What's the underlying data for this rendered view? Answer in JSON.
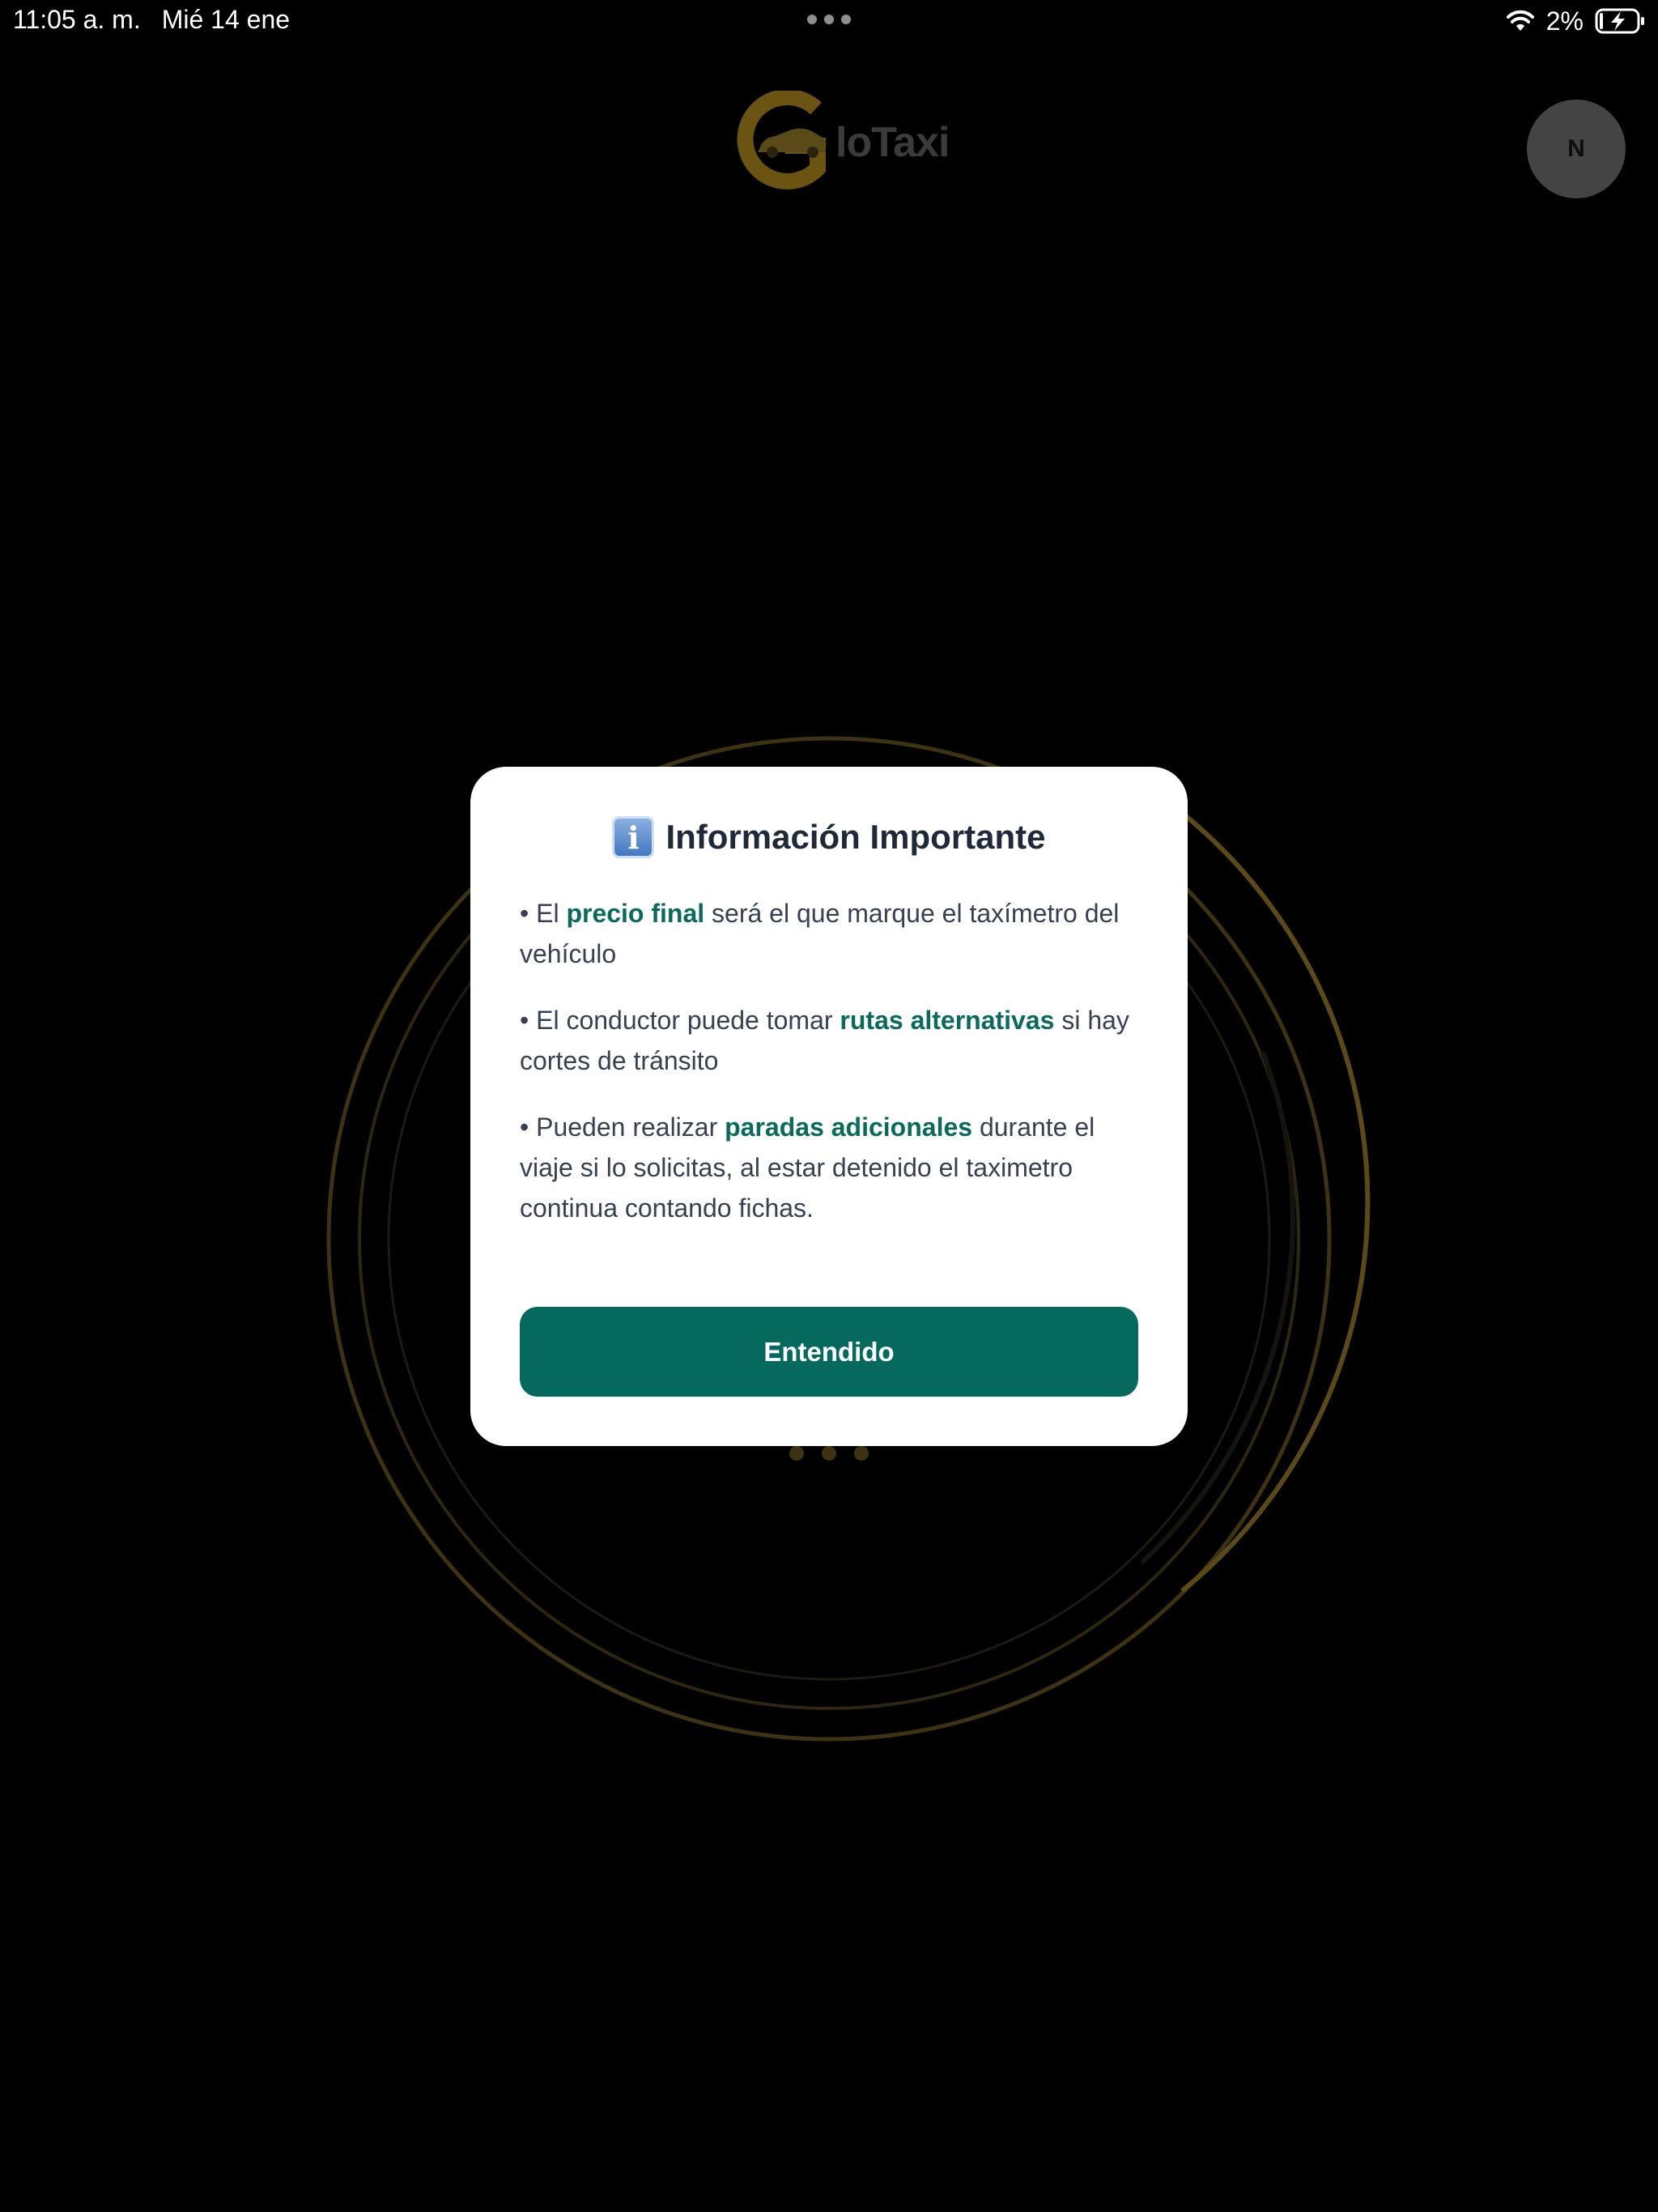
{
  "status_bar": {
    "time": "11:05 a. m.",
    "date": "Mié 14 ene",
    "battery_percent": "2%",
    "icons": [
      "more-dots-icon",
      "wifi-icon",
      "battery-charging-icon"
    ]
  },
  "header": {
    "logo_text": "loTaxi",
    "avatar_initial": "N"
  },
  "colors": {
    "background": "#000000",
    "accent_green": "#056a5d",
    "highlight_green": "#0a6a5b",
    "logo_gold": "#6b5412",
    "ring_gold": "#3d3212"
  },
  "modal": {
    "title_icon": "info-icon",
    "title_icon_glyph": "i",
    "title": "Información Importante",
    "bullets": [
      {
        "prefix": "• El ",
        "highlight": "precio final",
        "suffix": " será el que marque el taxímetro del vehículo"
      },
      {
        "prefix": "• El conductor puede tomar ",
        "highlight": "rutas alternativas",
        "suffix": " si hay cortes de tránsito"
      },
      {
        "prefix": "• Pueden realizar ",
        "highlight": "paradas adicionales",
        "suffix": " durante el viaje si lo solicitas, al estar detenido el taximetro continua contando fichas."
      }
    ],
    "button_label": "Entendido"
  }
}
